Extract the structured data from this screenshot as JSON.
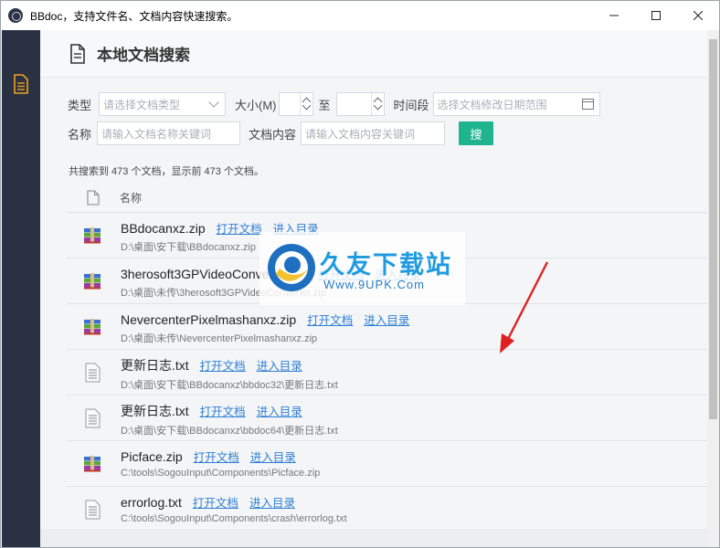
{
  "window": {
    "title": "BBdoc，支持文件名、文档内容快速搜索。"
  },
  "header": {
    "title": "本地文档搜索"
  },
  "filters": {
    "type_label": "类型",
    "type_placeholder": "请选择文档类型",
    "size_label": "大小(M)",
    "size_to_label": "至",
    "period_label": "时间段",
    "period_placeholder": "选择文档修改日期范围",
    "name_label": "名称",
    "name_placeholder": "请输入文档名称关键词",
    "content_label": "文档内容",
    "content_placeholder": "请输入文档内容关键词",
    "search_button": "搜"
  },
  "result_count": "共搜索到 473 个文档，显示前 473 个文档。",
  "table": {
    "column_name": "名称",
    "open_label": "打开文档",
    "dir_label": "进入目录",
    "rows": [
      {
        "name": "BBdocanxz.zip",
        "path": "D:\\桌面\\安下载\\BBdocanxz.zip",
        "icon": "winrar-archive-icon"
      },
      {
        "name": "3herosoft3GPVideoConverter.zip",
        "path": "D:\\桌面\\未传\\3herosoft3GPVideoConverter.zip",
        "icon": "winrar-archive-icon"
      },
      {
        "name": "NevercenterPixelmashanxz.zip",
        "path": "D:\\桌面\\未传\\NevercenterPixelmashanxz.zip",
        "icon": "winrar-archive-icon"
      },
      {
        "name": "更新日志.txt",
        "path": "D:\\桌面\\安下载\\BBdocanxz\\bbdoc32\\更新日志.txt",
        "icon": "text-file-icon"
      },
      {
        "name": "更新日志.txt",
        "path": "D:\\桌面\\安下载\\BBdocanxz\\bbdoc64\\更新日志.txt",
        "icon": "text-file-icon"
      },
      {
        "name": "Picface.zip",
        "path": "C:\\tools\\SogouInput\\Components\\Picface.zip",
        "icon": "winrar-archive-icon"
      },
      {
        "name": "errorlog.txt",
        "path": "C:\\tools\\SogouInput\\Components\\crash\\errorlog.txt",
        "icon": "text-file-icon"
      }
    ]
  },
  "watermark": {
    "brand": "久友下载站",
    "url": "Www.9UPK.Com"
  },
  "colors": {
    "sidebar": "#2a3142",
    "accent_green": "#1fb48e",
    "link_blue": "#2f7fd4",
    "annotation_red": "#e02020"
  }
}
